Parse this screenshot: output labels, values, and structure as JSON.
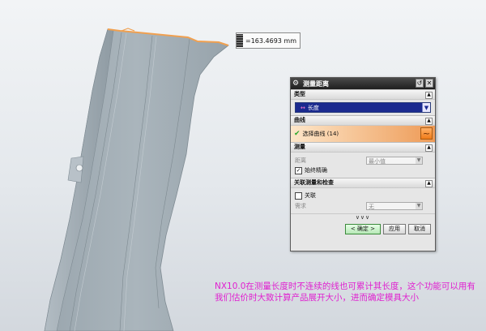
{
  "measurement": {
    "value": "=163.4693 mm"
  },
  "dialog": {
    "title": "测量距离",
    "sections": {
      "type": {
        "header": "类型",
        "value": "长度"
      },
      "curve": {
        "header": "曲线",
        "select_label": "选择曲线 (14)"
      },
      "measure": {
        "header": "测量",
        "distance_label": "距离",
        "distance_value": "最小值",
        "always_accurate_label": "始终精确",
        "always_accurate_checked": true
      },
      "associative": {
        "header": "关联测量和检查",
        "associate_label": "关联",
        "associate_checked": false,
        "requirement_label": "需求",
        "requirement_value": "无"
      }
    },
    "more_label": "∨∨∨",
    "buttons": {
      "ok": "< 确定 >",
      "apply": "应用",
      "cancel": "取消"
    }
  },
  "caption": "NX10.0在测量长度时不连续的线也可累计其长度，这个功能可以用有我们估价时大致计算产品展开大小，进而确定模具大小",
  "colors": {
    "part": "#a4b0b8",
    "highlight_edge": "#f0a050",
    "caption": "#e020d0"
  }
}
